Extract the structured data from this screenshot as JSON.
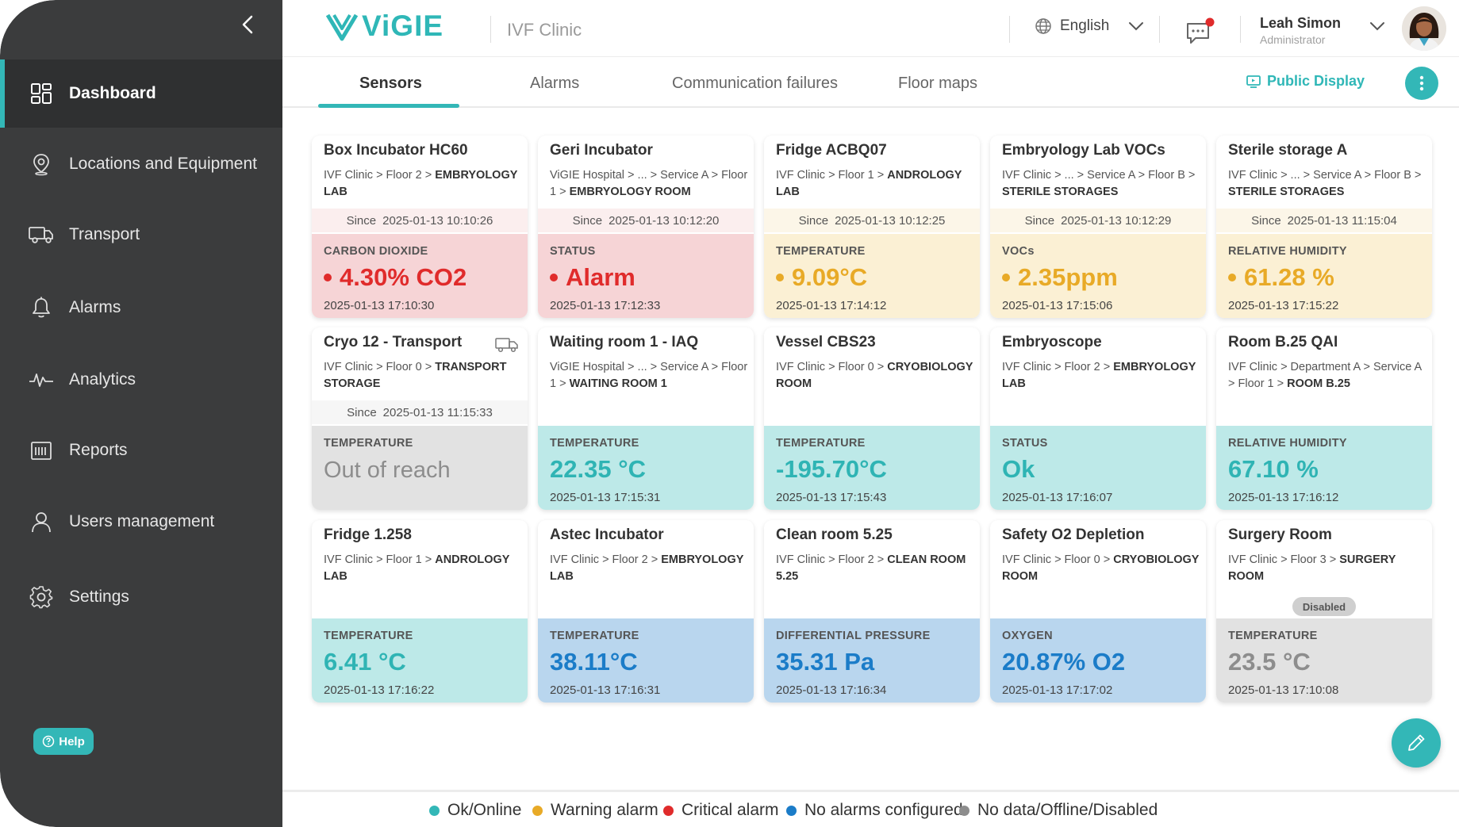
{
  "sidebar": {
    "items": [
      {
        "label": "Dashboard",
        "icon": "dashboard-icon"
      },
      {
        "label": "Locations  and Equipment",
        "icon": "location-pin-icon"
      },
      {
        "label": "Transport",
        "icon": "truck-icon"
      },
      {
        "label": "Alarms",
        "icon": "bell-icon"
      },
      {
        "label": "Analytics",
        "icon": "pulse-icon"
      },
      {
        "label": "Reports",
        "icon": "report-icon"
      },
      {
        "label": "Users management",
        "icon": "user-icon"
      },
      {
        "label": "Settings",
        "icon": "gear-icon"
      }
    ],
    "help_label": "Help"
  },
  "header": {
    "logo_text": "ViGIE",
    "clinic": "IVF Clinic",
    "language": "English",
    "user_name": "Leah Simon",
    "user_role": "Administrator"
  },
  "tabs": {
    "items": [
      "Sensors",
      "Alarms",
      "Communication failures",
      "Floor maps"
    ],
    "public_display": "Public Display"
  },
  "colors": {
    "accent": "#33b7b7",
    "critical": "#e02b2b",
    "warning": "#e8aa27",
    "ok": "#2fb4b4",
    "no_alarm": "#1b7cc8",
    "offline": "#8d8d8d"
  },
  "cards": [
    {
      "name": "Box Incubator HC60",
      "path": "IVF Clinic > Floor 2 >",
      "path_bold": "EMBRYOLOGY LAB",
      "since_label": "Since",
      "since": "2025-01-13 10:10:26",
      "label": "CARBON DIOXIDE",
      "value": "4.30% CO2",
      "time": "2025-01-13 17:10:30",
      "status": "crit"
    },
    {
      "name": "Geri Incubator",
      "path": "ViGIE Hospital > ... > Service A > Floor 1 >",
      "path_bold": "EMBRYOLOGY ROOM",
      "since_label": "Since",
      "since": "2025-01-13 10:12:20",
      "label": "STATUS",
      "value": "Alarm",
      "time": "2025-01-13 17:12:33",
      "status": "crit"
    },
    {
      "name": "Fridge ACBQ07",
      "path": "IVF Clinic > Floor 1 >",
      "path_bold": "ANDROLOGY LAB",
      "since_label": "Since",
      "since": "2025-01-13 10:12:25",
      "label": "TEMPERATURE",
      "value": "9.09°C",
      "time": "2025-01-13 17:14:12",
      "status": "warn"
    },
    {
      "name": "Embryology Lab VOCs",
      "path": "IVF Clinic > ... > Service A > Floor B >",
      "path_bold": "STERILE STORAGES",
      "since_label": "Since",
      "since": "2025-01-13 10:12:29",
      "label": "VOCs",
      "value": "2.35ppm",
      "time": "2025-01-13 17:15:06",
      "status": "warn"
    },
    {
      "name": "Sterile storage A",
      "path": "IVF Clinic > ... > Service A > Floor B >",
      "path_bold": "STERILE STORAGES",
      "since_label": "Since",
      "since": "2025-01-13 11:15:04",
      "label": "RELATIVE HUMIDITY",
      "value": "61.28 %",
      "time": "2025-01-13 17:15:22",
      "status": "warn"
    },
    {
      "name": "Cryo 12 - Transport",
      "path": "IVF Clinic > Floor 0 >",
      "path_bold": "TRANSPORT STORAGE",
      "since_label": "Since",
      "since": "2025-01-13 11:15:33",
      "label": "TEMPERATURE",
      "value": "Out of reach",
      "time": "",
      "status": "off",
      "truck": true
    },
    {
      "name": "Waiting room 1 - IAQ",
      "path": "ViGIE Hospital > ... > Service A > Floor 1 >",
      "path_bold": "WAITING ROOM 1",
      "label": "TEMPERATURE",
      "value": "22.35 °C",
      "time": "2025-01-13 17:15:31",
      "status": "ok"
    },
    {
      "name": "Vessel CBS23",
      "path": "IVF Clinic > Floor 0 >",
      "path_bold": "CRYOBIOLOGY ROOM",
      "label": "TEMPERATURE",
      "value": "-195.70°C",
      "time": "2025-01-13 17:15:43",
      "status": "ok"
    },
    {
      "name": "Embryoscope",
      "path": "IVF Clinic > Floor 2 >",
      "path_bold": "EMBRYOLOGY LAB",
      "label": "STATUS",
      "value": "Ok",
      "time": "2025-01-13 17:16:07",
      "status": "ok"
    },
    {
      "name": "Room B.25 QAI",
      "path": "IVF Clinic > Department A > Service A > Floor 1 >",
      "path_bold": "ROOM B.25",
      "label": "RELATIVE HUMIDITY",
      "value": "67.10 %",
      "time": "2025-01-13 17:16:12",
      "status": "ok"
    },
    {
      "name": "Fridge 1.258",
      "path": "IVF Clinic > Floor 1 >",
      "path_bold": "ANDROLOGY LAB",
      "label": "TEMPERATURE",
      "value": "6.41 °C",
      "time": "2025-01-13 17:16:22",
      "status": "ok"
    },
    {
      "name": "Astec Incubator",
      "path": "IVF Clinic > Floor 2 >",
      "path_bold": "EMBRYOLOGY LAB",
      "label": "TEMPERATURE",
      "value": "38.11°C",
      "time": "2025-01-13 17:16:31",
      "status": "none"
    },
    {
      "name": "Clean room 5.25",
      "path": "IVF Clinic > Floor 2 >",
      "path_bold": "CLEAN ROOM 5.25",
      "label": "DIFFERENTIAL PRESSURE",
      "value": "35.31 Pa",
      "time": "2025-01-13 17:16:34",
      "status": "none"
    },
    {
      "name": "Safety O2 Depletion",
      "path": "IVF Clinic > Floor 0 >",
      "path_bold": "CRYOBIOLOGY ROOM",
      "label": "OXYGEN",
      "value": "20.87% O2",
      "time": "2025-01-13 17:17:02",
      "status": "none"
    },
    {
      "name": "Surgery Room",
      "path": "IVF Clinic > Floor 3 >",
      "path_bold": "SURGERY ROOM",
      "disabled": "Disabled",
      "label": "TEMPERATURE",
      "value": "23.5 °C",
      "time": "2025-01-13 17:10:08",
      "status": "off"
    }
  ],
  "legend": [
    {
      "label": "Ok/Online",
      "color": "#33b7b7"
    },
    {
      "label": "Warning alarm",
      "color": "#e8aa27"
    },
    {
      "label": "Critical alarm",
      "color": "#e02b2b"
    },
    {
      "label": "No alarms configured",
      "color": "#1b7cc8"
    },
    {
      "label": "No data/Offline/Disabled",
      "color": "#8d8d8d"
    }
  ]
}
